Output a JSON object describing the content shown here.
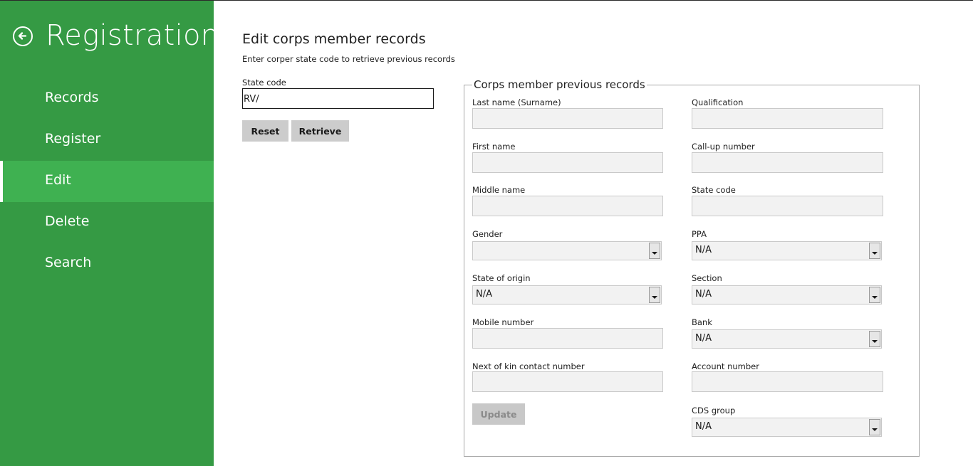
{
  "sidebar": {
    "title": "Registration",
    "items": [
      {
        "label": "Records",
        "active": false
      },
      {
        "label": "Register",
        "active": false
      },
      {
        "label": "Edit",
        "active": true
      },
      {
        "label": "Delete",
        "active": false
      },
      {
        "label": "Search",
        "active": false
      }
    ]
  },
  "main": {
    "title": "Edit corps member records",
    "subtitle": "Enter corper state code to retrieve previous records",
    "state_code_label": "State code",
    "state_code_value": "RV/",
    "reset_label": "Reset",
    "retrieve_label": "Retrieve"
  },
  "records": {
    "legend": "Corps member previous records",
    "left": {
      "last_name": {
        "label": "Last name (Surname)",
        "value": ""
      },
      "first_name": {
        "label": "First name",
        "value": ""
      },
      "middle_name": {
        "label": "Middle name",
        "value": ""
      },
      "gender": {
        "label": "Gender",
        "value": ""
      },
      "state_of_origin": {
        "label": "State of origin",
        "value": "N/A"
      },
      "mobile_number": {
        "label": "Mobile number",
        "value": ""
      },
      "next_of_kin": {
        "label": "Next of kin contact number",
        "value": ""
      }
    },
    "right": {
      "qualification": {
        "label": "Qualification",
        "value": ""
      },
      "call_up_number": {
        "label": "Call-up number",
        "value": ""
      },
      "state_code": {
        "label": "State code",
        "value": ""
      },
      "ppa": {
        "label": "PPA",
        "value": "N/A"
      },
      "section": {
        "label": "Section",
        "value": "N/A"
      },
      "bank": {
        "label": "Bank",
        "value": "N/A"
      },
      "account_number": {
        "label": "Account number",
        "value": ""
      },
      "cds_group": {
        "label": "CDS group",
        "value": "N/A"
      }
    },
    "update_label": "Update"
  },
  "colors": {
    "sidebar_bg": "#359a44",
    "sidebar_active": "#3fb151",
    "field_bg": "#f2f2f2",
    "button_bg": "#cccccc"
  }
}
